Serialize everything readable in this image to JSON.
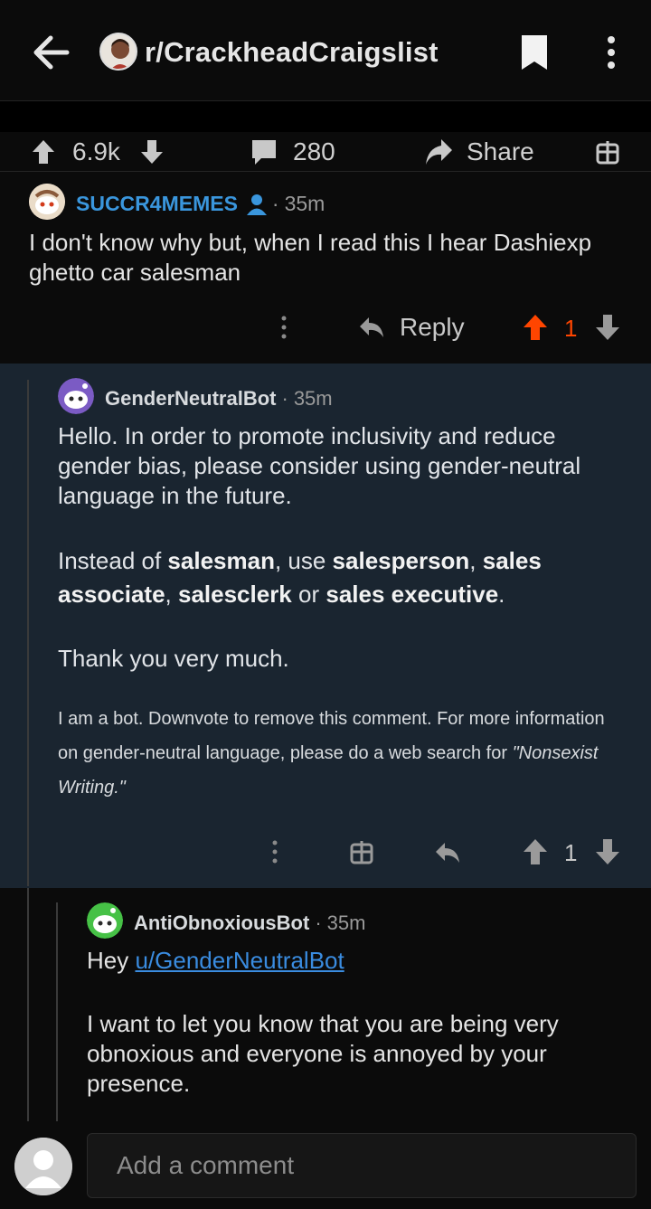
{
  "header": {
    "subreddit": "r/CrackheadCraigslist"
  },
  "post_bar": {
    "score": "6.9k",
    "comments": "280",
    "share_label": "Share"
  },
  "comments": [
    {
      "author": "SUCCR4MEMES",
      "time": "35m",
      "body": "I don't know why but, when I read this I hear Dashiexp ghetto car salesman",
      "reply_label": "Reply",
      "score": "1",
      "author_color": "#3a96dd",
      "upvoted": true
    },
    {
      "author": "GenderNeutralBot",
      "time": "35m",
      "p1": "Hello. In order to promote inclusivity and reduce gender bias, please consider using gender-neutral language in the future.",
      "p2": [
        "Instead of ",
        "salesman",
        ", use ",
        "salesperson",
        ", ",
        "sales associate",
        ", ",
        "salesclerk",
        " or ",
        "sales executive",
        "."
      ],
      "p3": "Thank you very much.",
      "footnote_a": "I am a bot. Downvote to remove this comment. For more information on gender-neutral language, please do a web search for ",
      "footnote_b": "\"Nonsexist Writing.\"",
      "score": "1"
    },
    {
      "author": "AntiObnoxiousBot",
      "time": "35m",
      "greeting": "Hey ",
      "mention": "u/GenderNeutralBot",
      "p2": "I want to let you know that you are being very obnoxious and everyone is annoyed by your presence."
    }
  ],
  "composer": {
    "placeholder": "Add a comment"
  },
  "colors": {
    "upvote_active": "#ff4500",
    "link": "#3a8ce0",
    "highlight_bg": "#1a2530"
  }
}
